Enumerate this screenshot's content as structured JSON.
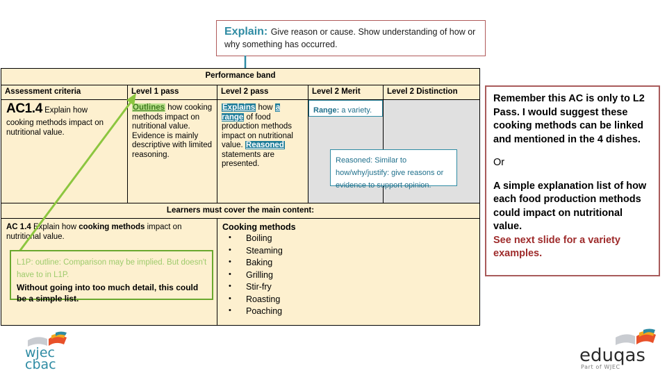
{
  "explain_callout": {
    "keyword": "Explain:",
    "text": "Give reason or cause. Show understanding of how or why something has occurred."
  },
  "table": {
    "performance_band": "Performance band",
    "columns": [
      "Assessment criteria",
      "Level 1 pass",
      "Level 2 pass",
      "Level 2 Merit",
      "Level 2 Distinction"
    ],
    "assessment_criteria": {
      "code": "AC1.4",
      "desc_inline": "Explain how",
      "desc_rest": "cooking methods impact on nutritional value."
    },
    "level1_pass": {
      "highlight": "Outlines",
      "text_after": " how cooking methods impact on nutritional value. Evidence is mainly descriptive with limited reasoning."
    },
    "level2_pass": {
      "highlight1": "Explains",
      "mid1": " how ",
      "highlight2": "a range",
      "mid2": " of food production methods impact on nutritional value. ",
      "highlight3": "Reasoned",
      "tail": " statements are presented."
    },
    "level2_merit": "",
    "level2_distinction": ""
  },
  "range_callout": {
    "label": "Range:",
    "text": " a variety."
  },
  "reasoned_callout": {
    "text": "Reasoned: Similar to how/why/justify: give reasons or evidence to support opinion."
  },
  "learners": {
    "header": "Learners must cover the main content:",
    "left": {
      "code": "AC 1.4",
      "part1": " Explain how ",
      "bold_phrase": "cooking methods",
      "part2": " impact on nutritional value."
    },
    "right": {
      "title": "Cooking methods",
      "items": [
        "Boiling",
        "Steaming",
        "Baking",
        "Grilling",
        "Stir-fry",
        "Roasting",
        "Poaching"
      ]
    }
  },
  "green_callout": {
    "green_text": "L1P: outline: Comparison may be implied. But doesn't have to in L1P.",
    "black_text": "Without going into too much detail, this could be a simple list."
  },
  "notes_panel": {
    "para1": "Remember this AC is only to L2 Pass. I would suggest these cooking methods can be linked and mentioned in the 4 dishes.",
    "para2": "Or",
    "para3": "A simple explanation list of how each food production methods could impact on nutritional value.",
    "para4": "See next  slide for a variety examples."
  },
  "logos": {
    "wjec_line1": "wjec",
    "wjec_line2": "cbac",
    "eduqas_name": "eduqas",
    "eduqas_tagline": "Part of WJEC"
  },
  "colors": {
    "table_fill": "#fdf0cf",
    "grey_fill": "#e0e0e0",
    "teal": "#1f7d99",
    "green_highlight": "#b9e08a",
    "red_border": "#a85a5a",
    "red_text": "#9e2b2b",
    "green_border": "#6aa82e"
  }
}
